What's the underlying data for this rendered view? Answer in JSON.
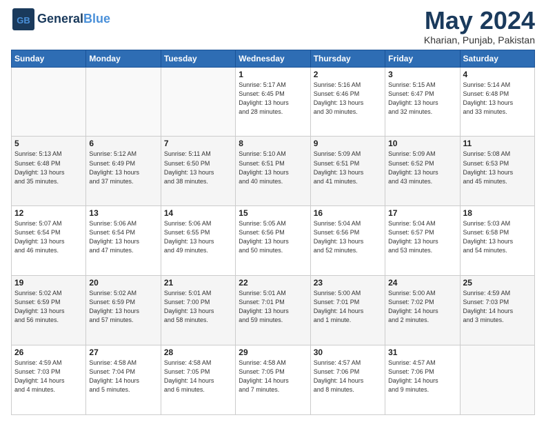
{
  "header": {
    "logo_line1": "General",
    "logo_line2": "Blue",
    "month": "May 2024",
    "location": "Kharian, Punjab, Pakistan"
  },
  "days_of_week": [
    "Sunday",
    "Monday",
    "Tuesday",
    "Wednesday",
    "Thursday",
    "Friday",
    "Saturday"
  ],
  "weeks": [
    [
      {
        "day": "",
        "info": ""
      },
      {
        "day": "",
        "info": ""
      },
      {
        "day": "",
        "info": ""
      },
      {
        "day": "1",
        "info": "Sunrise: 5:17 AM\nSunset: 6:45 PM\nDaylight: 13 hours\nand 28 minutes."
      },
      {
        "day": "2",
        "info": "Sunrise: 5:16 AM\nSunset: 6:46 PM\nDaylight: 13 hours\nand 30 minutes."
      },
      {
        "day": "3",
        "info": "Sunrise: 5:15 AM\nSunset: 6:47 PM\nDaylight: 13 hours\nand 32 minutes."
      },
      {
        "day": "4",
        "info": "Sunrise: 5:14 AM\nSunset: 6:48 PM\nDaylight: 13 hours\nand 33 minutes."
      }
    ],
    [
      {
        "day": "5",
        "info": "Sunrise: 5:13 AM\nSunset: 6:48 PM\nDaylight: 13 hours\nand 35 minutes."
      },
      {
        "day": "6",
        "info": "Sunrise: 5:12 AM\nSunset: 6:49 PM\nDaylight: 13 hours\nand 37 minutes."
      },
      {
        "day": "7",
        "info": "Sunrise: 5:11 AM\nSunset: 6:50 PM\nDaylight: 13 hours\nand 38 minutes."
      },
      {
        "day": "8",
        "info": "Sunrise: 5:10 AM\nSunset: 6:51 PM\nDaylight: 13 hours\nand 40 minutes."
      },
      {
        "day": "9",
        "info": "Sunrise: 5:09 AM\nSunset: 6:51 PM\nDaylight: 13 hours\nand 41 minutes."
      },
      {
        "day": "10",
        "info": "Sunrise: 5:09 AM\nSunset: 6:52 PM\nDaylight: 13 hours\nand 43 minutes."
      },
      {
        "day": "11",
        "info": "Sunrise: 5:08 AM\nSunset: 6:53 PM\nDaylight: 13 hours\nand 45 minutes."
      }
    ],
    [
      {
        "day": "12",
        "info": "Sunrise: 5:07 AM\nSunset: 6:54 PM\nDaylight: 13 hours\nand 46 minutes."
      },
      {
        "day": "13",
        "info": "Sunrise: 5:06 AM\nSunset: 6:54 PM\nDaylight: 13 hours\nand 47 minutes."
      },
      {
        "day": "14",
        "info": "Sunrise: 5:06 AM\nSunset: 6:55 PM\nDaylight: 13 hours\nand 49 minutes."
      },
      {
        "day": "15",
        "info": "Sunrise: 5:05 AM\nSunset: 6:56 PM\nDaylight: 13 hours\nand 50 minutes."
      },
      {
        "day": "16",
        "info": "Sunrise: 5:04 AM\nSunset: 6:56 PM\nDaylight: 13 hours\nand 52 minutes."
      },
      {
        "day": "17",
        "info": "Sunrise: 5:04 AM\nSunset: 6:57 PM\nDaylight: 13 hours\nand 53 minutes."
      },
      {
        "day": "18",
        "info": "Sunrise: 5:03 AM\nSunset: 6:58 PM\nDaylight: 13 hours\nand 54 minutes."
      }
    ],
    [
      {
        "day": "19",
        "info": "Sunrise: 5:02 AM\nSunset: 6:59 PM\nDaylight: 13 hours\nand 56 minutes."
      },
      {
        "day": "20",
        "info": "Sunrise: 5:02 AM\nSunset: 6:59 PM\nDaylight: 13 hours\nand 57 minutes."
      },
      {
        "day": "21",
        "info": "Sunrise: 5:01 AM\nSunset: 7:00 PM\nDaylight: 13 hours\nand 58 minutes."
      },
      {
        "day": "22",
        "info": "Sunrise: 5:01 AM\nSunset: 7:01 PM\nDaylight: 13 hours\nand 59 minutes."
      },
      {
        "day": "23",
        "info": "Sunrise: 5:00 AM\nSunset: 7:01 PM\nDaylight: 14 hours\nand 1 minute."
      },
      {
        "day": "24",
        "info": "Sunrise: 5:00 AM\nSunset: 7:02 PM\nDaylight: 14 hours\nand 2 minutes."
      },
      {
        "day": "25",
        "info": "Sunrise: 4:59 AM\nSunset: 7:03 PM\nDaylight: 14 hours\nand 3 minutes."
      }
    ],
    [
      {
        "day": "26",
        "info": "Sunrise: 4:59 AM\nSunset: 7:03 PM\nDaylight: 14 hours\nand 4 minutes."
      },
      {
        "day": "27",
        "info": "Sunrise: 4:58 AM\nSunset: 7:04 PM\nDaylight: 14 hours\nand 5 minutes."
      },
      {
        "day": "28",
        "info": "Sunrise: 4:58 AM\nSunset: 7:05 PM\nDaylight: 14 hours\nand 6 minutes."
      },
      {
        "day": "29",
        "info": "Sunrise: 4:58 AM\nSunset: 7:05 PM\nDaylight: 14 hours\nand 7 minutes."
      },
      {
        "day": "30",
        "info": "Sunrise: 4:57 AM\nSunset: 7:06 PM\nDaylight: 14 hours\nand 8 minutes."
      },
      {
        "day": "31",
        "info": "Sunrise: 4:57 AM\nSunset: 7:06 PM\nDaylight: 14 hours\nand 9 minutes."
      },
      {
        "day": "",
        "info": ""
      }
    ]
  ]
}
